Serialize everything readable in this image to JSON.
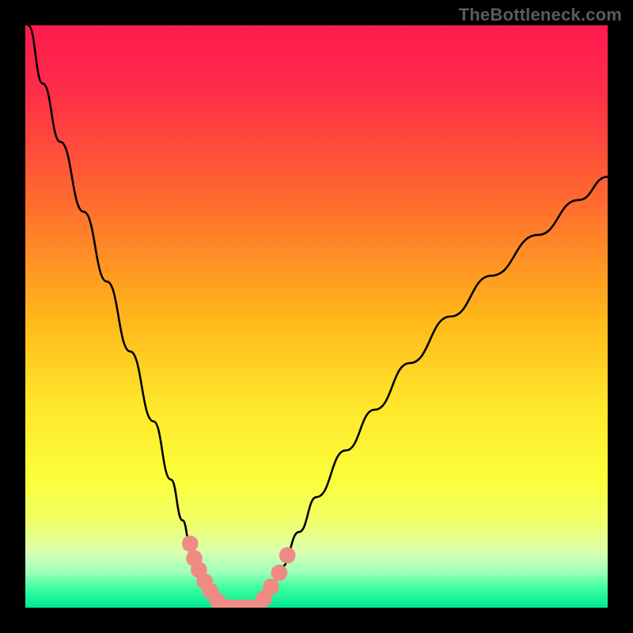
{
  "watermark": "TheBottleneck.com",
  "chart_data": {
    "type": "line",
    "title": "",
    "xlabel": "",
    "ylabel": "",
    "xlim": [
      0,
      100
    ],
    "ylim": [
      0,
      100
    ],
    "gradient_stops": [
      {
        "offset": 0.0,
        "color": "#ff1a4f"
      },
      {
        "offset": 0.12,
        "color": "#ff2f47"
      },
      {
        "offset": 0.3,
        "color": "#ff6a2f"
      },
      {
        "offset": 0.5,
        "color": "#ffb61a"
      },
      {
        "offset": 0.65,
        "color": "#ffe62a"
      },
      {
        "offset": 0.78,
        "color": "#fbff3a"
      },
      {
        "offset": 0.85,
        "color": "#f0ff66"
      },
      {
        "offset": 0.905,
        "color": "#d8ffb0"
      },
      {
        "offset": 0.94,
        "color": "#9cffb8"
      },
      {
        "offset": 0.965,
        "color": "#40ffa0"
      },
      {
        "offset": 1.0,
        "color": "#00e893"
      }
    ],
    "series": [
      {
        "name": "left-curve",
        "x": [
          0.5,
          3,
          6,
          10,
          14,
          18,
          22,
          25,
          27,
          28.5,
          30,
          32,
          34
        ],
        "y": [
          100,
          90,
          80,
          68,
          56,
          44,
          32,
          22,
          15,
          10,
          6,
          2,
          0
        ]
      },
      {
        "name": "right-curve",
        "x": [
          40,
          42,
          44,
          47,
          50,
          55,
          60,
          66,
          73,
          80,
          88,
          95,
          100
        ],
        "y": [
          0,
          3,
          7,
          13,
          19,
          27,
          34,
          42,
          50,
          57,
          64,
          70,
          74
        ]
      },
      {
        "name": "left-markers",
        "type": "scatter",
        "x": [
          28.3,
          29.0,
          29.8,
          30.8,
          31.8,
          33.0,
          34.0
        ],
        "y": [
          11.0,
          8.5,
          6.5,
          4.5,
          2.8,
          1.2,
          0.2
        ]
      },
      {
        "name": "right-markers",
        "type": "scatter",
        "x": [
          40.0,
          41.0,
          42.2,
          43.6,
          45.0
        ],
        "y": [
          0.2,
          1.6,
          3.6,
          6.0,
          9.0
        ]
      },
      {
        "name": "valley-floor",
        "type": "scatter",
        "x": [
          35.0,
          36.0,
          37.0,
          38.0,
          39.0
        ],
        "y": [
          0.0,
          0.0,
          0.0,
          0.0,
          0.0
        ]
      }
    ],
    "marker_style": {
      "color": "#ef8a85",
      "radius_pct": 1.4
    },
    "stroke_style": {
      "color": "#000000",
      "width_pct": 0.35
    }
  }
}
